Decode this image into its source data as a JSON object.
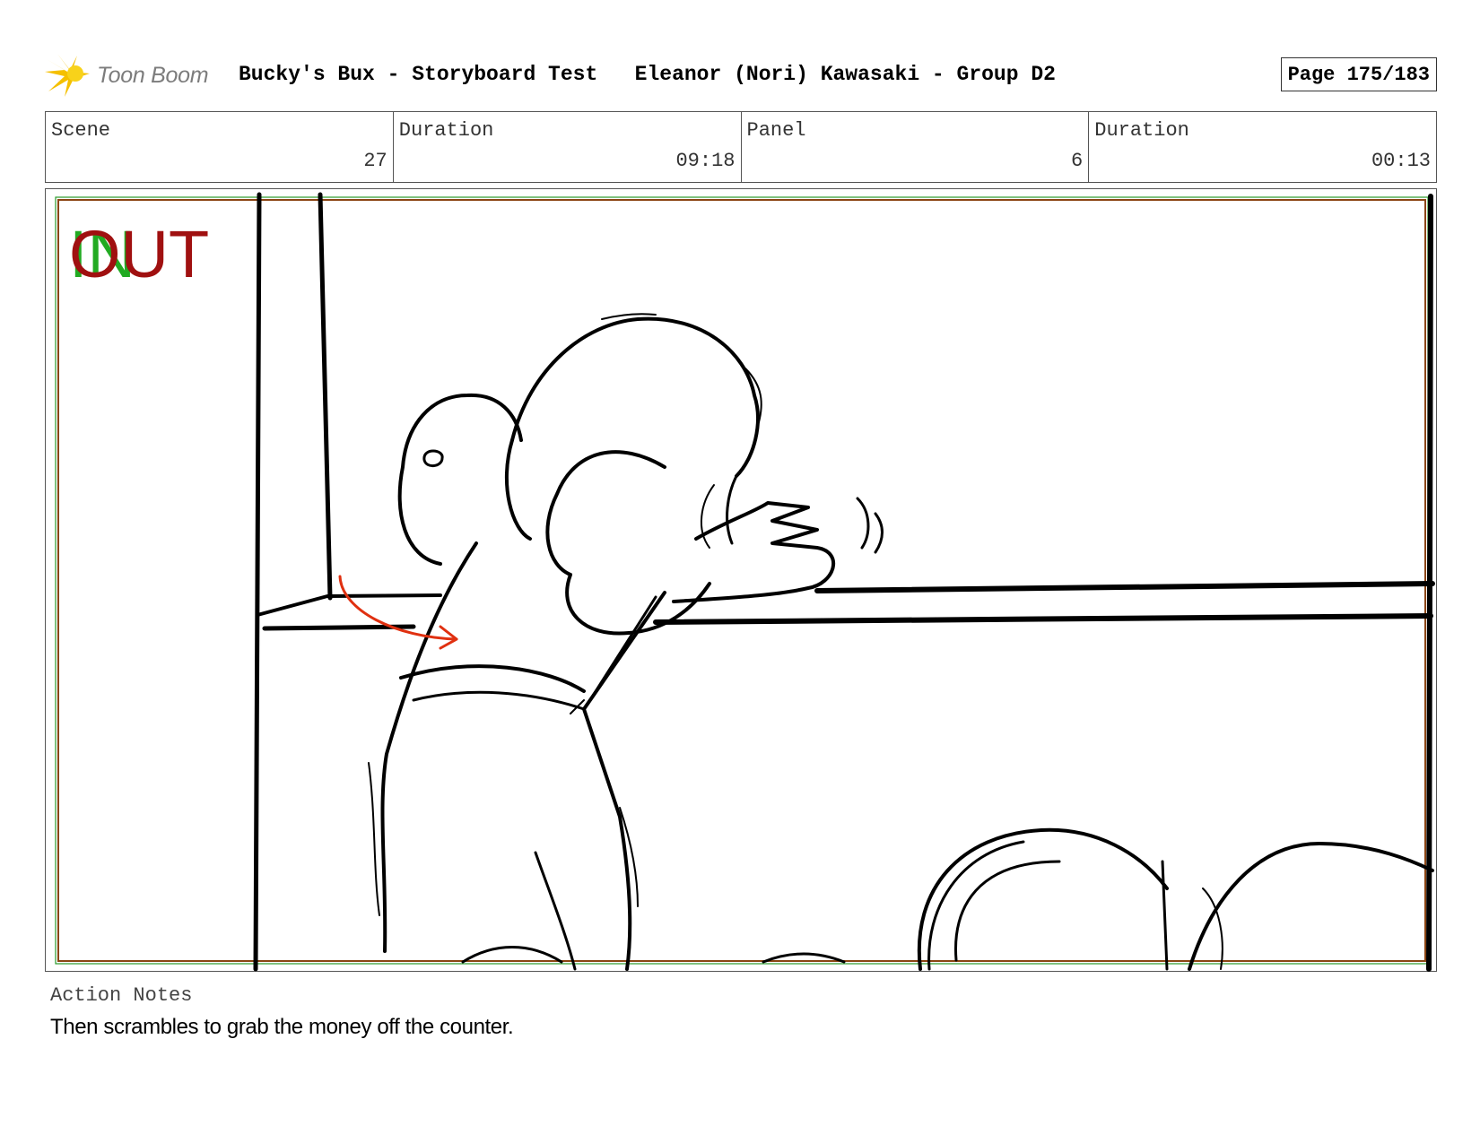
{
  "header": {
    "logo_text": "Toon Boom",
    "project_title": "Bucky's Bux - Storyboard Test   Eleanor (Nori) Kawasaki - Group D2",
    "page_label": "Page 175/183"
  },
  "info": [
    {
      "label": "Scene",
      "value": "27"
    },
    {
      "label": "Duration",
      "value": "09:18"
    },
    {
      "label": "Panel",
      "value": "6"
    },
    {
      "label": "Duration",
      "value": "00:13"
    }
  ],
  "panel": {
    "in_marker": "IN",
    "out_marker": "OUT",
    "colors": {
      "in": "#22aa22",
      "out": "#a01010",
      "arrow": "#e03010",
      "frame_inner": "#8b4513"
    }
  },
  "notes": {
    "label": "Action Notes",
    "text": "Then scrambles to grab the money off the counter."
  }
}
